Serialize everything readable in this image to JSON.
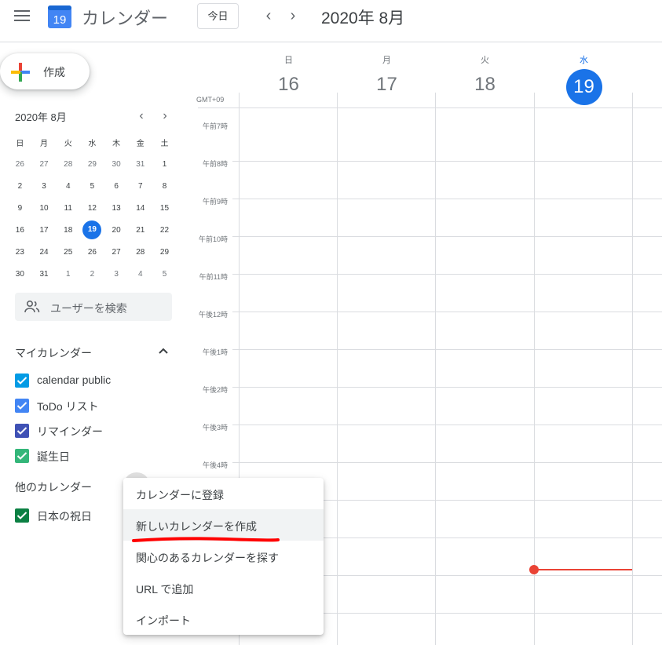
{
  "header": {
    "logo_day": "19",
    "app_title": "カレンダー",
    "today_label": "今日",
    "prev_icon": "chevron-left-icon",
    "next_icon": "chevron-right-icon",
    "current_range": "2020年 8月"
  },
  "create": {
    "label": "作成"
  },
  "mini_calendar": {
    "title": "2020年 8月",
    "weekday_headers": [
      "日",
      "月",
      "火",
      "水",
      "木",
      "金",
      "土"
    ],
    "weeks": [
      [
        "26",
        "27",
        "28",
        "29",
        "30",
        "31",
        "1"
      ],
      [
        "2",
        "3",
        "4",
        "5",
        "6",
        "7",
        "8"
      ],
      [
        "9",
        "10",
        "11",
        "12",
        "13",
        "14",
        "15"
      ],
      [
        "16",
        "17",
        "18",
        "19",
        "20",
        "21",
        "22"
      ],
      [
        "23",
        "24",
        "25",
        "26",
        "27",
        "28",
        "29"
      ],
      [
        "30",
        "31",
        "1",
        "2",
        "3",
        "4",
        "5"
      ]
    ],
    "today": "19"
  },
  "search_people": {
    "placeholder": "ユーザーを検索"
  },
  "my_calendars": {
    "title": "マイカレンダー",
    "items": [
      {
        "label": "calendar public",
        "color": "#039be5"
      },
      {
        "label": "ToDo リスト",
        "color": "#4285f4"
      },
      {
        "label": "リマインダー",
        "color": "#3f51b5"
      },
      {
        "label": "誕生日",
        "color": "#33b679"
      }
    ]
  },
  "other_calendars": {
    "title": "他のカレンダー",
    "items": [
      {
        "label": "日本の祝日",
        "color": "#0b8043"
      }
    ]
  },
  "week": {
    "timezone": "GMT+09",
    "days": [
      {
        "dow": "日",
        "num": "16"
      },
      {
        "dow": "月",
        "num": "17"
      },
      {
        "dow": "火",
        "num": "18"
      },
      {
        "dow": "水",
        "num": "19",
        "today": true
      }
    ],
    "hours": [
      "午前7時",
      "午前8時",
      "午前9時",
      "午前10時",
      "午前11時",
      "午後12時",
      "午後1時",
      "午後2時",
      "午後3時",
      "午後4時"
    ]
  },
  "menu": {
    "items": [
      "カレンダーに登録",
      "新しいカレンダーを作成",
      "関心のあるカレンダーを探す",
      "URL で追加",
      "インポート"
    ]
  },
  "colors": {
    "accent": "#1a73e8",
    "now_indicator": "#ea4335",
    "annotation": "#ff0000"
  }
}
